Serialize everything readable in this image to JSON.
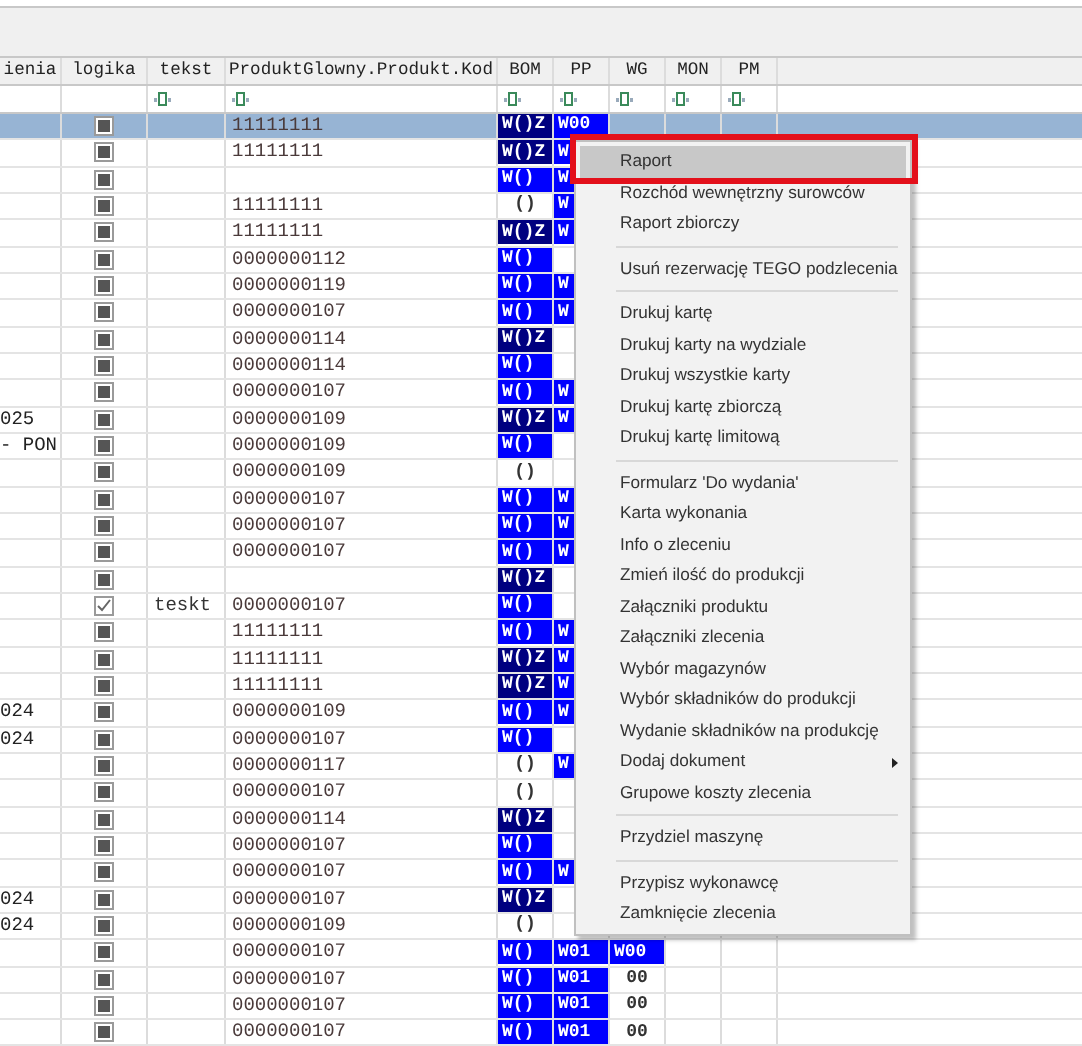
{
  "columns": [
    {
      "label": "ienia",
      "filter": false
    },
    {
      "label": "logika",
      "filter": false
    },
    {
      "label": "tekst",
      "filter": true
    },
    {
      "label": "ProduktGlowny.Produkt.Kod",
      "filter": true
    },
    {
      "label": "BOM",
      "filter": true
    },
    {
      "label": "PP",
      "filter": true
    },
    {
      "label": "WG",
      "filter": true
    },
    {
      "label": "MON",
      "filter": true
    },
    {
      "label": "PM",
      "filter": true
    }
  ],
  "rows": [
    {
      "selected": true,
      "checked": false,
      "kod": "11111111",
      "bom": {
        "text": "W()Z",
        "color": "#000080"
      },
      "pp": {
        "text": "W00",
        "color": "#0000ff"
      }
    },
    {
      "selected": false,
      "checked": false,
      "kod": "11111111",
      "bom": {
        "text": "W()Z",
        "color": "#000080"
      },
      "pp": {
        "text": "W",
        "color": "#0000ff"
      }
    },
    {
      "selected": false,
      "checked": false,
      "bom": {
        "text": "W()",
        "color": "#0000ff"
      },
      "pp": {
        "text": "W",
        "color": "#0000ff"
      }
    },
    {
      "selected": false,
      "checked": false,
      "kod": "11111111",
      "bom": {
        "text": "()",
        "color": "#ffffff"
      },
      "pp": {
        "text": "W",
        "color": "#0000ff"
      }
    },
    {
      "selected": false,
      "checked": false,
      "kod": "11111111",
      "bom": {
        "text": "W()Z",
        "color": "#000080"
      },
      "pp": {
        "text": "W",
        "color": "#0000ff"
      }
    },
    {
      "selected": false,
      "checked": false,
      "kod": "0000000112",
      "bom": {
        "text": "W()",
        "color": "#0000ff"
      }
    },
    {
      "selected": false,
      "checked": false,
      "kod": "0000000119",
      "bom": {
        "text": "W()",
        "color": "#0000ff"
      },
      "pp": {
        "text": "W",
        "color": "#0000ff"
      }
    },
    {
      "selected": false,
      "checked": false,
      "kod": "0000000107",
      "bom": {
        "text": "W()",
        "color": "#0000ff"
      },
      "pp": {
        "text": "W",
        "color": "#0000ff"
      }
    },
    {
      "selected": false,
      "checked": false,
      "kod": "0000000114",
      "bom": {
        "text": "W()Z",
        "color": "#000080"
      }
    },
    {
      "selected": false,
      "checked": false,
      "kod": "0000000114",
      "bom": {
        "text": "W()",
        "color": "#0000ff"
      }
    },
    {
      "selected": false,
      "checked": false,
      "kod": "0000000107",
      "bom": {
        "text": "W()",
        "color": "#0000ff"
      },
      "pp": {
        "text": "W",
        "color": "#0000ff"
      }
    },
    {
      "selected": false,
      "checked": false,
      "c1": "025",
      "kod": "0000000109",
      "bom": {
        "text": "W()Z",
        "color": "#000080"
      },
      "pp": {
        "text": "W",
        "color": "#0000ff"
      }
    },
    {
      "selected": false,
      "checked": false,
      "c1": "- PON",
      "kod": "0000000109",
      "bom": {
        "text": "W()",
        "color": "#0000ff"
      }
    },
    {
      "selected": false,
      "checked": false,
      "kod": "0000000109",
      "bom": {
        "text": "()",
        "color": "#ffffff"
      }
    },
    {
      "selected": false,
      "checked": false,
      "kod": "0000000107",
      "bom": {
        "text": "W()",
        "color": "#0000ff"
      },
      "pp": {
        "text": "W",
        "color": "#0000ff"
      }
    },
    {
      "selected": false,
      "checked": false,
      "kod": "0000000107",
      "bom": {
        "text": "W()",
        "color": "#0000ff"
      },
      "pp": {
        "text": "W",
        "color": "#0000ff"
      }
    },
    {
      "selected": false,
      "checked": false,
      "kod": "0000000107",
      "bom": {
        "text": "W()",
        "color": "#0000ff"
      },
      "pp": {
        "text": "W",
        "color": "#0000ff"
      }
    },
    {
      "selected": false,
      "checked": false,
      "bom": {
        "text": "W()Z",
        "color": "#000080"
      }
    },
    {
      "selected": false,
      "checked": true,
      "tekst": "teskt",
      "kod": "0000000107",
      "bom": {
        "text": "W()",
        "color": "#0000ff"
      }
    },
    {
      "selected": false,
      "checked": false,
      "kod": "11111111",
      "bom": {
        "text": "W()",
        "color": "#0000ff"
      },
      "pp": {
        "text": "W",
        "color": "#0000ff"
      }
    },
    {
      "selected": false,
      "checked": false,
      "kod": "11111111",
      "bom": {
        "text": "W()Z",
        "color": "#000080"
      },
      "pp": {
        "text": "W",
        "color": "#0000ff"
      }
    },
    {
      "selected": false,
      "checked": false,
      "kod": "11111111",
      "bom": {
        "text": "W()Z",
        "color": "#000080"
      },
      "pp": {
        "text": "W",
        "color": "#0000ff"
      }
    },
    {
      "selected": false,
      "checked": false,
      "c1": "024",
      "kod": "0000000109",
      "bom": {
        "text": "W()",
        "color": "#0000ff"
      },
      "pp": {
        "text": "W",
        "color": "#0000ff"
      }
    },
    {
      "selected": false,
      "checked": false,
      "c1": "024",
      "kod": "0000000107",
      "bom": {
        "text": "W()",
        "color": "#0000ff"
      }
    },
    {
      "selected": false,
      "checked": false,
      "kod": "0000000117",
      "bom": {
        "text": "()",
        "color": "#ffffff"
      },
      "pp": {
        "text": "W",
        "color": "#0000ff"
      }
    },
    {
      "selected": false,
      "checked": false,
      "kod": "0000000107",
      "bom": {
        "text": "()",
        "color": "#ffffff"
      }
    },
    {
      "selected": false,
      "checked": false,
      "kod": "0000000114",
      "bom": {
        "text": "W()Z",
        "color": "#000080"
      }
    },
    {
      "selected": false,
      "checked": false,
      "kod": "0000000107",
      "bom": {
        "text": "W()",
        "color": "#0000ff"
      }
    },
    {
      "selected": false,
      "checked": false,
      "kod": "0000000107",
      "bom": {
        "text": "W()",
        "color": "#0000ff"
      },
      "pp": {
        "text": "W",
        "color": "#0000ff"
      }
    },
    {
      "selected": false,
      "checked": false,
      "c1": "024",
      "kod": "0000000107",
      "bom": {
        "text": "W()Z",
        "color": "#000080"
      }
    },
    {
      "selected": false,
      "checked": false,
      "c1": "024",
      "kod": "0000000109",
      "bom": {
        "text": "()",
        "color": "#ffffff"
      }
    },
    {
      "selected": false,
      "checked": false,
      "kod": "0000000107",
      "bom": {
        "text": "W()",
        "color": "#0000ff"
      },
      "pp": {
        "text": "W01",
        "color": "#0000ff"
      },
      "wg": {
        "text": "W00",
        "color": "#0000ff"
      }
    },
    {
      "selected": false,
      "checked": false,
      "kod": "0000000107",
      "bom": {
        "text": "W()",
        "color": "#0000ff"
      },
      "pp": {
        "text": "W01",
        "color": "#0000ff"
      },
      "wg": {
        "text": "00",
        "color": "#ffffff"
      }
    },
    {
      "selected": false,
      "checked": false,
      "kod": "0000000107",
      "bom": {
        "text": "W()",
        "color": "#0000ff"
      },
      "pp": {
        "text": "W01",
        "color": "#0000ff"
      },
      "wg": {
        "text": "00",
        "color": "#ffffff"
      }
    },
    {
      "selected": false,
      "checked": false,
      "kod": "0000000107",
      "bom": {
        "text": "W()",
        "color": "#0000ff"
      },
      "pp": {
        "text": "W01",
        "color": "#0000ff"
      },
      "wg": {
        "text": "00",
        "color": "#ffffff"
      }
    }
  ],
  "context_menu": {
    "items": [
      {
        "kind": "item",
        "label": "Raport",
        "selected": true
      },
      {
        "kind": "item",
        "label": "Rozchód wewnętrzny surowców",
        "selected": false
      },
      {
        "kind": "item",
        "label": "Raport zbiorczy",
        "selected": false
      },
      {
        "kind": "separator"
      },
      {
        "kind": "item",
        "label": "Usuń rezerwację TEGO podzlecenia",
        "selected": false
      },
      {
        "kind": "separator"
      },
      {
        "kind": "item",
        "label": "Drukuj kartę",
        "selected": false
      },
      {
        "kind": "item",
        "label": "Drukuj karty na wydziale",
        "selected": false
      },
      {
        "kind": "item",
        "label": "Drukuj wszystkie karty",
        "selected": false
      },
      {
        "kind": "item",
        "label": "Drukuj kartę zbiorczą",
        "selected": false
      },
      {
        "kind": "item",
        "label": "Drukuj kartę limitową",
        "selected": false
      },
      {
        "kind": "separator"
      },
      {
        "kind": "item",
        "label": "Formularz 'Do wydania'",
        "selected": false
      },
      {
        "kind": "item",
        "label": "Karta wykonania",
        "selected": false
      },
      {
        "kind": "item",
        "label": "Info o zleceniu",
        "selected": false
      },
      {
        "kind": "item",
        "label": "Zmień ilość do produkcji",
        "selected": false
      },
      {
        "kind": "item",
        "label": "Załączniki produktu",
        "selected": false
      },
      {
        "kind": "item",
        "label": "Załączniki zlecenia",
        "selected": false
      },
      {
        "kind": "item",
        "label": "Wybór magazynów",
        "selected": false
      },
      {
        "kind": "item",
        "label": "Wybór składników do produkcji",
        "selected": false
      },
      {
        "kind": "item",
        "label": "Wydanie składników na produkcję",
        "selected": false
      },
      {
        "kind": "submenu",
        "label": "Dodaj dokument",
        "selected": false
      },
      {
        "kind": "item",
        "label": "Grupowe koszty zlecenia",
        "selected": false
      },
      {
        "kind": "separator"
      },
      {
        "kind": "item",
        "label": "Przydziel maszynę",
        "selected": false
      },
      {
        "kind": "separator"
      },
      {
        "kind": "item",
        "label": "Przypisz wykonawcę",
        "selected": false
      },
      {
        "kind": "item",
        "label": "Zamknięcie zlecenia",
        "selected": false
      }
    ]
  }
}
